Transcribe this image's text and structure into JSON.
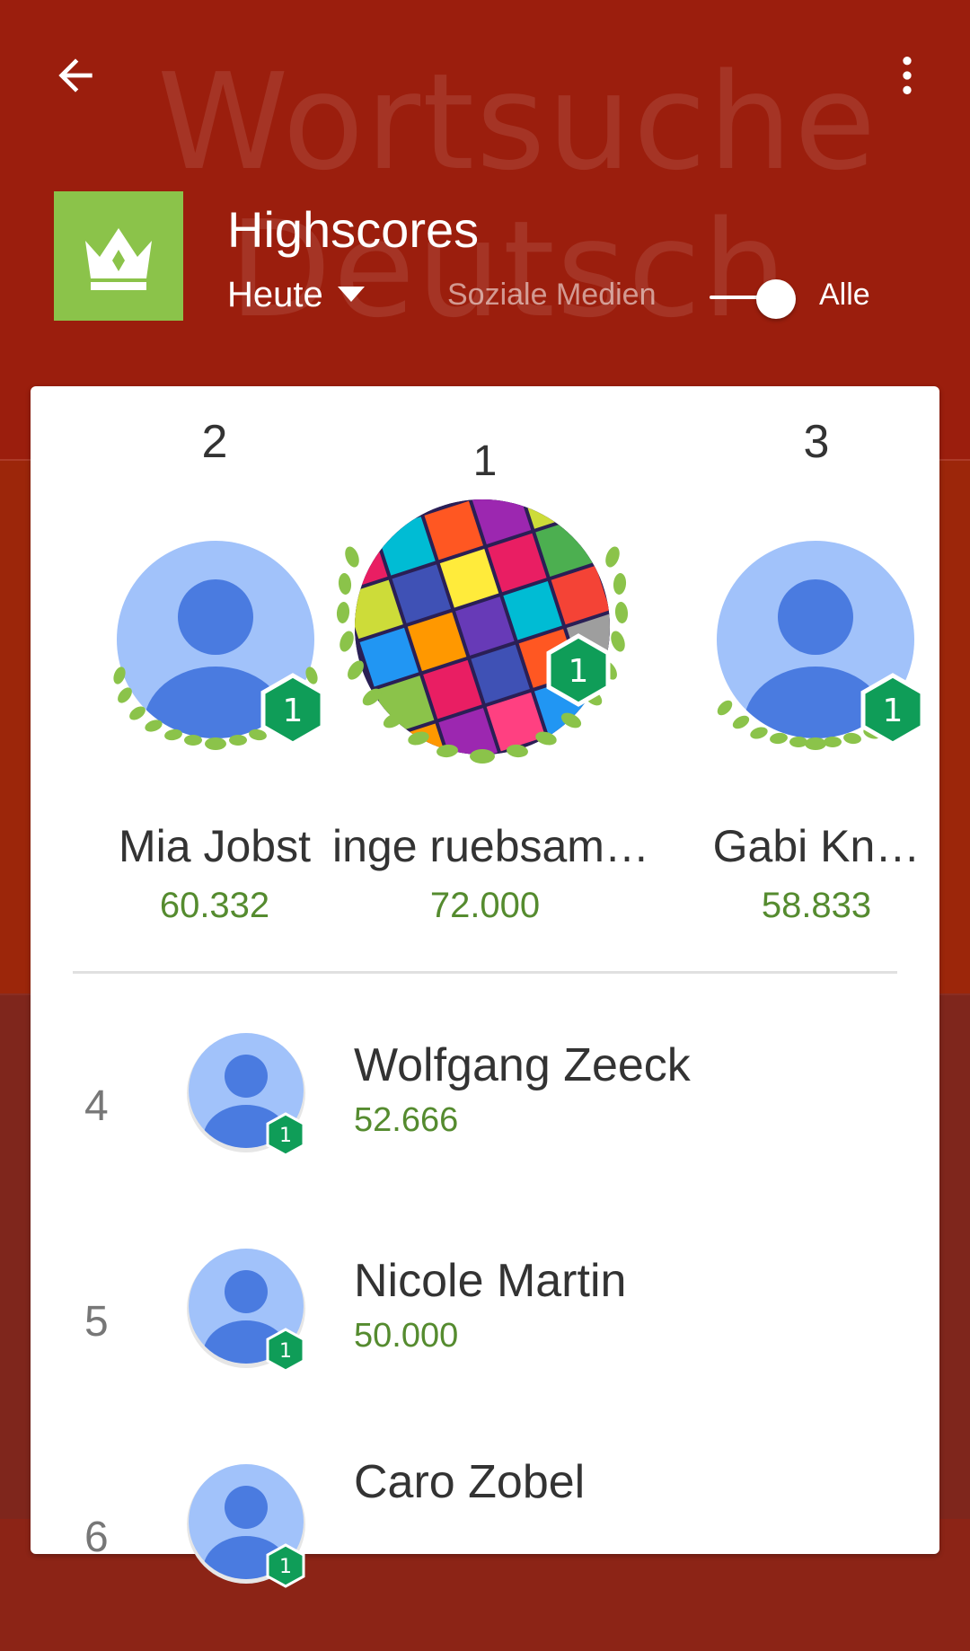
{
  "background": {
    "watermark_line1": "Wortsuche",
    "watermark_line2": "Deutsch"
  },
  "toolbar": {
    "back_icon": "arrow-back-icon",
    "menu_icon": "more-vert-icon"
  },
  "header": {
    "crown_icon": "crown-icon",
    "title": "Highscores",
    "period": "Heute",
    "social_label": "Soziale Medien",
    "all_label": "Alle",
    "toggle_on": true
  },
  "podium": [
    {
      "rank": "2",
      "name": "Mia Jobst",
      "score": "60.332",
      "level": "1"
    },
    {
      "rank": "1",
      "name": "inge ruebsam…",
      "score": "72.000",
      "level": "1"
    },
    {
      "rank": "3",
      "name": "Gabi Kn…",
      "score": "58.833",
      "level": "1"
    }
  ],
  "list": [
    {
      "rank": "4",
      "name": "Wolfgang Zeeck",
      "score": "52.666",
      "level": "1"
    },
    {
      "rank": "5",
      "name": "Nicole Martin",
      "score": "50.000",
      "level": "1"
    },
    {
      "rank": "6",
      "name": "Caro Zobel",
      "score": "",
      "level": "1"
    }
  ],
  "colors": {
    "header_red": "#9b1e0d",
    "crown_green": "#8bc34a",
    "score_green": "#558b2f",
    "badge_green": "#0f9d58",
    "avatar_light": "#a1c2fa",
    "avatar_dark": "#4a7be0",
    "laurel": "#8bc34a"
  }
}
